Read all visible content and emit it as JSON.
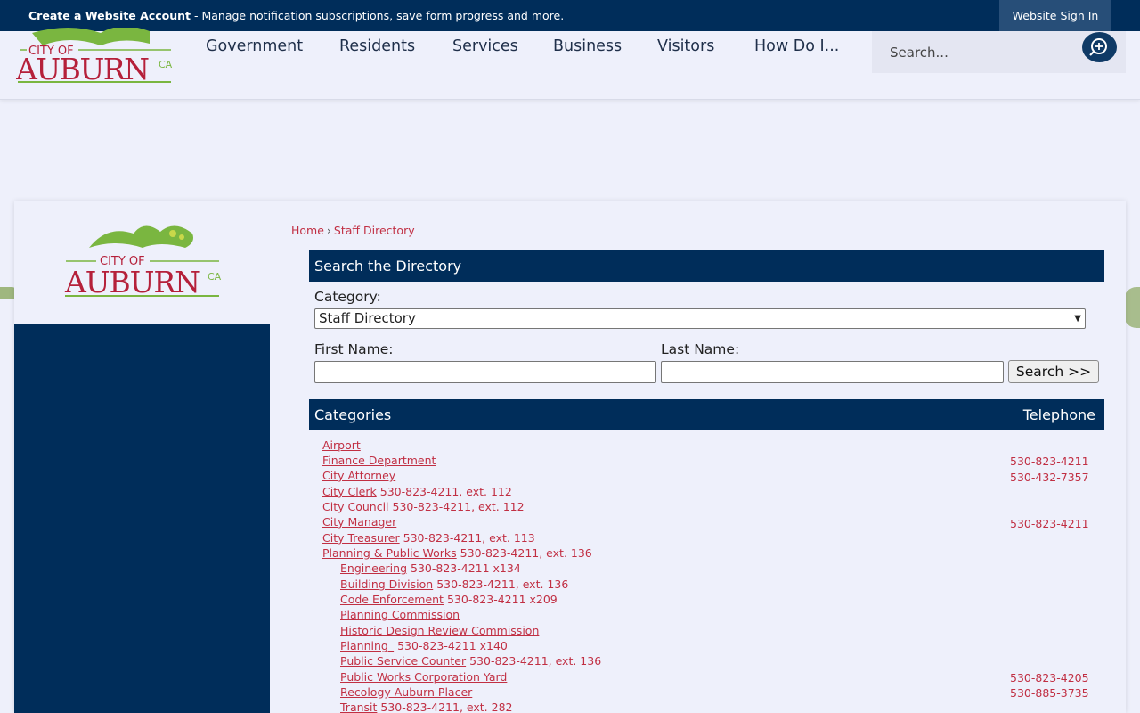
{
  "topbar": {
    "create_account": "Create a Website Account",
    "create_account_desc": "- Manage notification subscriptions, save form progress and more.",
    "signin_label": "Website Sign In"
  },
  "logo": {
    "city_of": "CITY OF",
    "name": "AUBURN",
    "state": "CA"
  },
  "nav": [
    {
      "label": "Government"
    },
    {
      "label": "Residents"
    },
    {
      "label": "Services"
    },
    {
      "label": "Business"
    },
    {
      "label": "Visitors"
    },
    {
      "label": "How Do I..."
    }
  ],
  "search": {
    "placeholder": "Search..."
  },
  "breadcrumb": {
    "home": "Home",
    "current": "Staff Directory"
  },
  "directory": {
    "title": "Search the Directory",
    "category_label": "Category:",
    "category_value": "Staff Directory",
    "first_name_label": "First Name:",
    "last_name_label": "Last Name:",
    "search_button": "Search >>"
  },
  "categories": {
    "header": "Categories",
    "telephone_header": "Telephone",
    "items": [
      {
        "name": "Airport",
        "inline_phone": "",
        "phone": ""
      },
      {
        "name": "Finance Department",
        "inline_phone": "",
        "phone": "530-823-4211"
      },
      {
        "name": "City Attorney",
        "inline_phone": "",
        "phone": "530-432-7357"
      },
      {
        "name": "City Clerk",
        "inline_phone": "530-823-4211, ext. 112",
        "phone": ""
      },
      {
        "name": "City Council",
        "inline_phone": "530-823-4211, ext. 112",
        "phone": ""
      },
      {
        "name": "City Manager",
        "inline_phone": "",
        "phone": "530-823-4211"
      },
      {
        "name": "City Treasurer",
        "inline_phone": "530-823-4211, ext. 113",
        "phone": ""
      },
      {
        "name": "Planning & Public Works",
        "inline_phone": "530-823-4211, ext. 136",
        "phone": ""
      },
      {
        "name": "Engineering",
        "inline_phone": "530-823-4211 x134",
        "phone": ""
      },
      {
        "name": "Building Division",
        "inline_phone": "530-823-4211, ext. 136",
        "phone": ""
      },
      {
        "name": "Code Enforcement",
        "inline_phone": "530-823-4211 x209",
        "phone": ""
      },
      {
        "name": "Planning Commission",
        "inline_phone": "",
        "phone": ""
      },
      {
        "name": "Historic Design Review Commission",
        "inline_phone": "",
        "phone": ""
      },
      {
        "name": "Planning_",
        "inline_phone": "530-823-4211 x140",
        "phone": ""
      },
      {
        "name": "Public Service Counter",
        "inline_phone": "530-823-4211, ext. 136",
        "phone": ""
      },
      {
        "name": "Public Works Corporation Yard",
        "inline_phone": "",
        "phone": "530-823-4205"
      },
      {
        "name": "Recology Auburn Placer",
        "inline_phone": "",
        "phone": "530-885-3735"
      },
      {
        "name": "Transit",
        "inline_phone": "530-823-4211, ext. 282",
        "phone": ""
      }
    ]
  },
  "colors": {
    "navy": "#002d5a",
    "link_red": "#c12f43",
    "logo_green": "#7ab640",
    "logo_red": "#b5203a"
  }
}
